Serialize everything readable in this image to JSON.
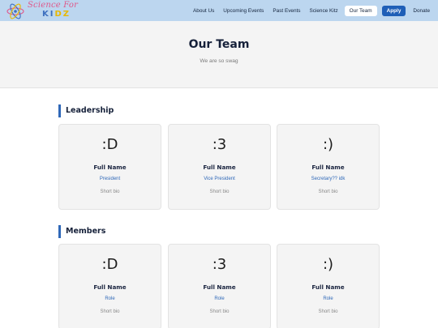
{
  "logo": {
    "line1": "Science For",
    "line2_a": "KI",
    "line2_b": "DZ"
  },
  "nav": {
    "about": "About Us",
    "upcoming": "Upcoming Events",
    "past": "Past Events",
    "kitz": "Science Kitz",
    "team": "Our Team",
    "apply": "Apply",
    "donate": "Donate"
  },
  "hero": {
    "title": "Our Team",
    "subtitle": "We are so swag"
  },
  "leadership": {
    "title": "Leadership",
    "cards": [
      {
        "emote": ":D",
        "name": "Full Name",
        "role": "President",
        "bio": "Short bio"
      },
      {
        "emote": ":3",
        "name": "Full Name",
        "role": "Vice President",
        "bio": "Short bio"
      },
      {
        "emote": ":)",
        "name": "Full Name",
        "role": "Secretary?? idk",
        "bio": "Short bio"
      }
    ]
  },
  "members": {
    "title": "Members",
    "cards": [
      {
        "emote": ":D",
        "name": "Full Name",
        "role": "Role",
        "bio": "Short bio"
      },
      {
        "emote": ":3",
        "name": "Full Name",
        "role": "Role",
        "bio": "Short bio"
      },
      {
        "emote": ":)",
        "name": "Full Name",
        "role": "Role",
        "bio": "Short bio"
      }
    ]
  },
  "colors": {
    "navbar": "#bcd6ef",
    "accent": "#2f68b8",
    "apply_button": "#1f5fb7",
    "logo_pink": "#e0578a"
  }
}
